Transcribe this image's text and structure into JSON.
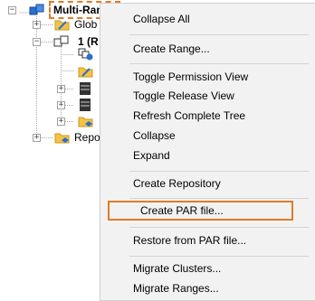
{
  "tree": {
    "root_label": "Multi-Range",
    "nodes": [
      {
        "label": "Glob"
      },
      {
        "label": "1 (R"
      },
      {
        "label": "Repo"
      }
    ]
  },
  "context_menu": {
    "items": [
      "Collapse All",
      "Create Range...",
      "Toggle Permission View",
      "Toggle Release View",
      "Refresh Complete Tree",
      "Collapse",
      "Expand",
      "Create Repository",
      "Create PAR file...",
      "Restore from PAR file...",
      "Migrate Clusters...",
      "Migrate Ranges..."
    ],
    "highlighted_item": "Create PAR file..."
  },
  "colors": {
    "highlight_border": "#e07b28",
    "menu_background": "#f2f2f2",
    "folder_yellow": "#f5c242",
    "icon_blue": "#2a6fd0"
  }
}
